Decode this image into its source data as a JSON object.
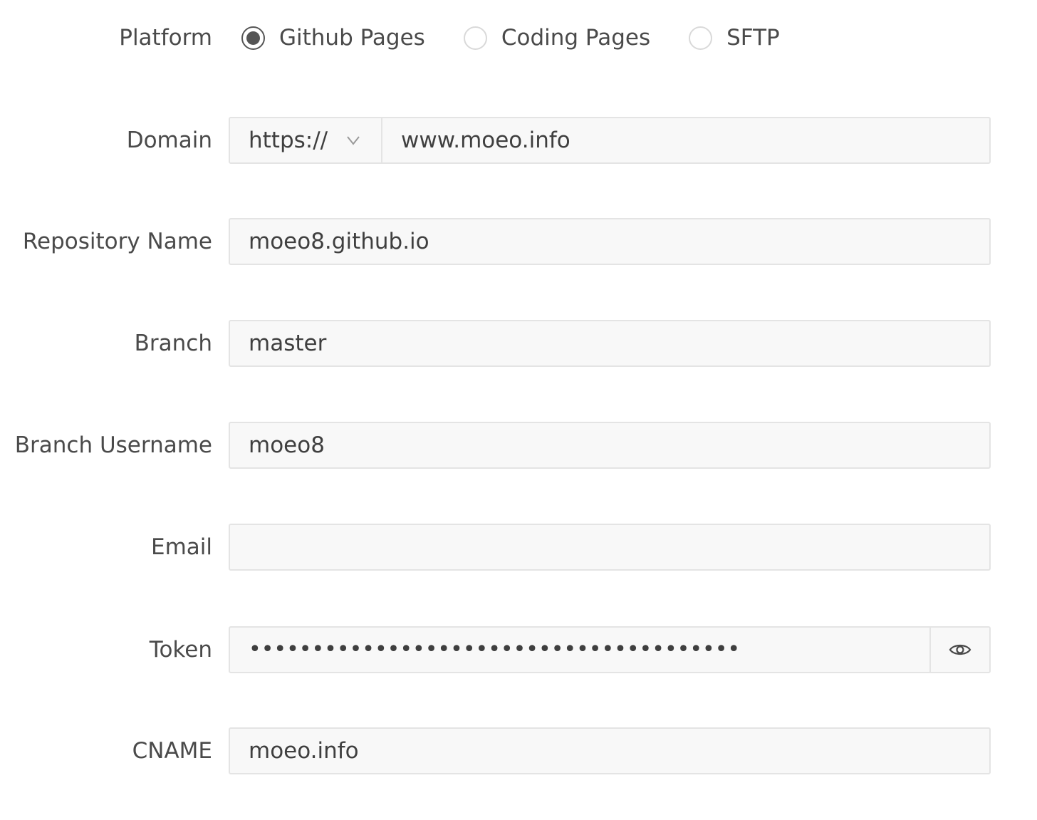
{
  "platform": {
    "label": "Platform",
    "options": [
      {
        "label": "Github Pages",
        "checked": true
      },
      {
        "label": "Coding Pages",
        "checked": false
      },
      {
        "label": "SFTP",
        "checked": false
      }
    ]
  },
  "domain": {
    "label": "Domain",
    "protocol": "https://",
    "value": "www.moeo.info"
  },
  "repository": {
    "label": "Repository Name",
    "value": "moeo8.github.io"
  },
  "branch": {
    "label": "Branch",
    "value": "master"
  },
  "branch_username": {
    "label": "Branch Username",
    "value": "moeo8"
  },
  "email": {
    "label": "Email",
    "value": ""
  },
  "token": {
    "label": "Token",
    "value": "•••••••••••••••••••••••••••••••••••••••"
  },
  "cname": {
    "label": "CNAME",
    "value": "moeo.info"
  },
  "colors": {
    "field_background": "#f8f8f8",
    "field_border": "#e4e4e4",
    "radio_checked": "#555555",
    "text": "#4a4a4a"
  }
}
